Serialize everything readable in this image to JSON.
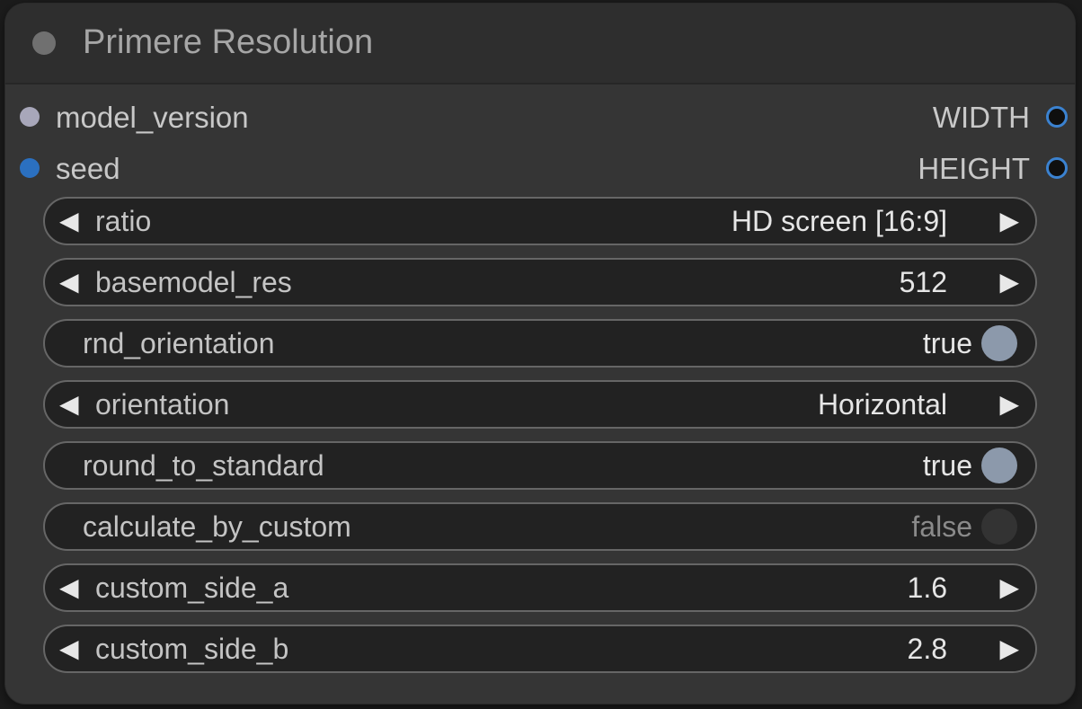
{
  "node": {
    "title": "Primere Resolution"
  },
  "inputs": [
    {
      "name": "model_version",
      "color": "#a8a7ba"
    },
    {
      "name": "seed",
      "color": "#2b70c0"
    }
  ],
  "outputs": [
    {
      "name": "WIDTH",
      "color": "#3b82d0"
    },
    {
      "name": "HEIGHT",
      "color": "#3b82d0"
    }
  ],
  "widgets": {
    "ratio": {
      "label": "ratio",
      "value": "HD screen [16:9]",
      "left_arrow": "◀",
      "right_arrow": "▶"
    },
    "basemodel_res": {
      "label": "basemodel_res",
      "value": "512",
      "left_arrow": "◀",
      "right_arrow": "▶"
    },
    "rnd_orientation": {
      "label": "rnd_orientation",
      "value": "true"
    },
    "orientation": {
      "label": "orientation",
      "value": "Horizontal",
      "left_arrow": "◀",
      "right_arrow": "▶"
    },
    "round_to_standard": {
      "label": "round_to_standard",
      "value": "true"
    },
    "calculate_by_custom": {
      "label": "calculate_by_custom",
      "value": "false"
    },
    "custom_side_a": {
      "label": "custom_side_a",
      "value": "1.6",
      "left_arrow": "◀",
      "right_arrow": "▶"
    },
    "custom_side_b": {
      "label": "custom_side_b",
      "value": "2.8",
      "left_arrow": "◀",
      "right_arrow": "▶"
    }
  },
  "colors": {
    "node_bg": "#353535",
    "title_bg": "#2e2e2e",
    "widget_bg": "#222222",
    "widget_border": "#666666",
    "toggle_on": "#8c99ab",
    "toggle_off": "#333333"
  }
}
